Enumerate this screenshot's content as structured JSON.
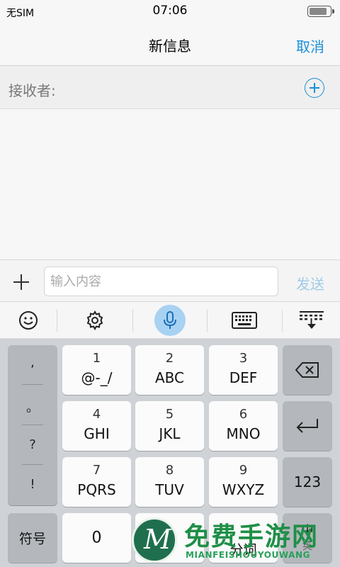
{
  "status_bar": {
    "sim_text": "无SIM",
    "time": "07:06",
    "battery_level": 0.85
  },
  "nav": {
    "title": "新信息",
    "cancel_label": "取消"
  },
  "recipient": {
    "label": "接收者:"
  },
  "compose": {
    "placeholder": "输入内容",
    "send_label": "发送"
  },
  "keyboard_toolbar": {
    "items": [
      "emoji-icon",
      "settings-gear-icon",
      "microphone-icon",
      "keyboard-icon",
      "collapse-keyboard-icon"
    ]
  },
  "keyboard": {
    "punctuation": [
      ",",
      "。",
      "?",
      "!"
    ],
    "keys": [
      {
        "num": "1",
        "letters": "@-_/"
      },
      {
        "num": "2",
        "letters": "ABC"
      },
      {
        "num": "3",
        "letters": "DEF"
      },
      {
        "num": "4",
        "letters": "GHI"
      },
      {
        "num": "5",
        "letters": "JKL"
      },
      {
        "num": "6",
        "letters": "MNO"
      },
      {
        "num": "7",
        "letters": "PQRS"
      },
      {
        "num": "8",
        "letters": "TUV"
      },
      {
        "num": "9",
        "letters": "WXYZ"
      }
    ],
    "symbols_label": "符号",
    "zero_label": "0",
    "segment_label": "分词",
    "lang_label": "中",
    "lang_sub_label": "英",
    "numeric_label": "123"
  },
  "watermark": {
    "title": "免费手游网",
    "subtitle": "MIANFEISHOUYOUWANG",
    "logo_letter": "M"
  },
  "colors": {
    "accent": "#1a8fd8",
    "send_disabled": "#9fcbe9",
    "watermark_green": "#1f8f47"
  }
}
